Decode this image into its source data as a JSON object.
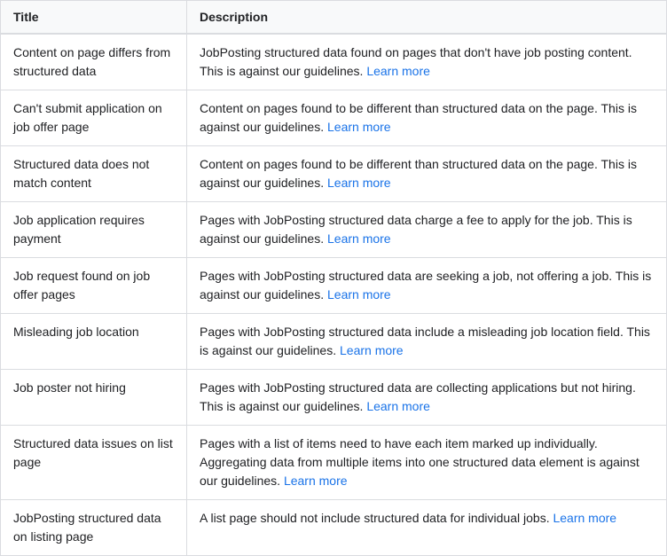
{
  "table": {
    "headers": {
      "title": "Title",
      "description": "Description"
    },
    "rows": [
      {
        "id": "row-1",
        "title": "Content on page differs from structured data",
        "description": "JobPosting structured data found on pages that don't have job posting content. This is against our guidelines.",
        "learn_more_text": "Learn more",
        "learn_more_url": "#"
      },
      {
        "id": "row-2",
        "title": "Can't submit application on job offer page",
        "description": "Content on pages found to be different than structured data on the page. This is against our guidelines.",
        "learn_more_text": "Learn more",
        "learn_more_url": "#"
      },
      {
        "id": "row-3",
        "title": "Structured data does not match content",
        "description": "Content on pages found to be different than structured data on the page. This is against our guidelines.",
        "learn_more_text": "Learn more",
        "learn_more_url": "#"
      },
      {
        "id": "row-4",
        "title": "Job application requires payment",
        "description": "Pages with JobPosting structured data charge a fee to apply for the job. This is against our guidelines.",
        "learn_more_text": "Learn more",
        "learn_more_url": "#"
      },
      {
        "id": "row-5",
        "title": "Job request found on job offer pages",
        "description": "Pages with JobPosting structured data are seeking a job, not offering a job. This is against our guidelines.",
        "learn_more_text": "Learn more",
        "learn_more_url": "#"
      },
      {
        "id": "row-6",
        "title": "Misleading job location",
        "description": "Pages with JobPosting structured data include a misleading job location field. This is against our guidelines.",
        "learn_more_text": "Learn more",
        "learn_more_url": "#"
      },
      {
        "id": "row-7",
        "title": "Job poster not hiring",
        "description": "Pages with JobPosting structured data are collecting applications but not hiring. This is against our guidelines.",
        "learn_more_text": "Learn more",
        "learn_more_url": "#"
      },
      {
        "id": "row-8",
        "title": "Structured data issues on list page",
        "description": "Pages with a list of items need to have each item marked up individually. Aggregating data from multiple items into one structured data element is against our guidelines.",
        "learn_more_text": "Learn more",
        "learn_more_url": "#"
      },
      {
        "id": "row-9",
        "title": "JobPosting structured data on listing page",
        "description": "A list page should not include structured data for individual jobs.",
        "learn_more_text": "Learn more",
        "learn_more_url": "#"
      }
    ]
  }
}
